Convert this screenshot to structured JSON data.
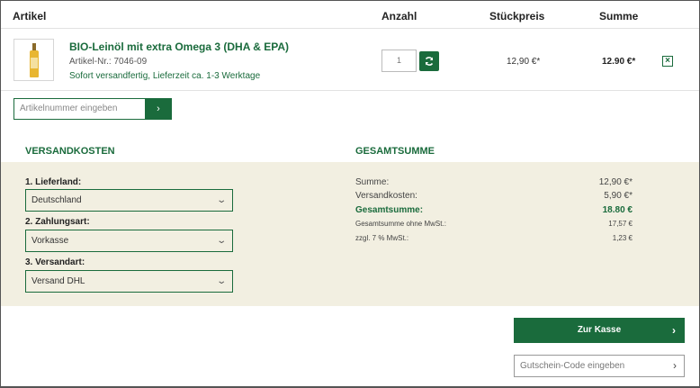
{
  "table": {
    "headers": {
      "artikel": "Artikel",
      "anzahl": "Anzahl",
      "stueckpreis": "Stückpreis",
      "summe": "Summe"
    }
  },
  "item": {
    "name": "BIO-Leinöl mit extra Omega 3 (DHA & EPA)",
    "article_number": "Artikel-Nr.: 7046-09",
    "shipping_info": "Sofort versandfertig, Lieferzeit ca. 1-3 Werktage",
    "quantity": "1",
    "unit_price": "12,90 €*",
    "total": "12.90 €*",
    "remove_label": "×",
    "image_icon": "product-bottle-icon"
  },
  "sku_entry": {
    "placeholder": "Artikelnummer eingeben",
    "button_label": "›"
  },
  "shipping": {
    "title": "VERSANDKOSTEN",
    "country": {
      "label": "1. Lieferland:",
      "value": "Deutschland"
    },
    "payment": {
      "label": "2. Zahlungsart:",
      "value": "Vorkasse"
    },
    "method": {
      "label": "3. Versandart:",
      "value": "Versand DHL"
    }
  },
  "totals": {
    "title": "GESAMTSUMME",
    "rows": [
      {
        "label": "Summe:",
        "value": "12,90 €*"
      },
      {
        "label": "Versandkosten:",
        "value": "5,90 €*"
      },
      {
        "label": "Gesamtsumme:",
        "value": "18.80 €"
      },
      {
        "label": "Gesamtsumme ohne MwSt.:",
        "value": "17,57 €"
      },
      {
        "label": "zzgl. 7 % MwSt.:",
        "value": "1,23 €"
      }
    ]
  },
  "actions": {
    "checkout_label": "Zur Kasse",
    "checkout_arrow": "›",
    "coupon_placeholder": "Gutschein-Code eingeben",
    "coupon_arrow": "›"
  },
  "colors": {
    "brand": "#1a6b3c",
    "panel": "#f2efe1"
  }
}
